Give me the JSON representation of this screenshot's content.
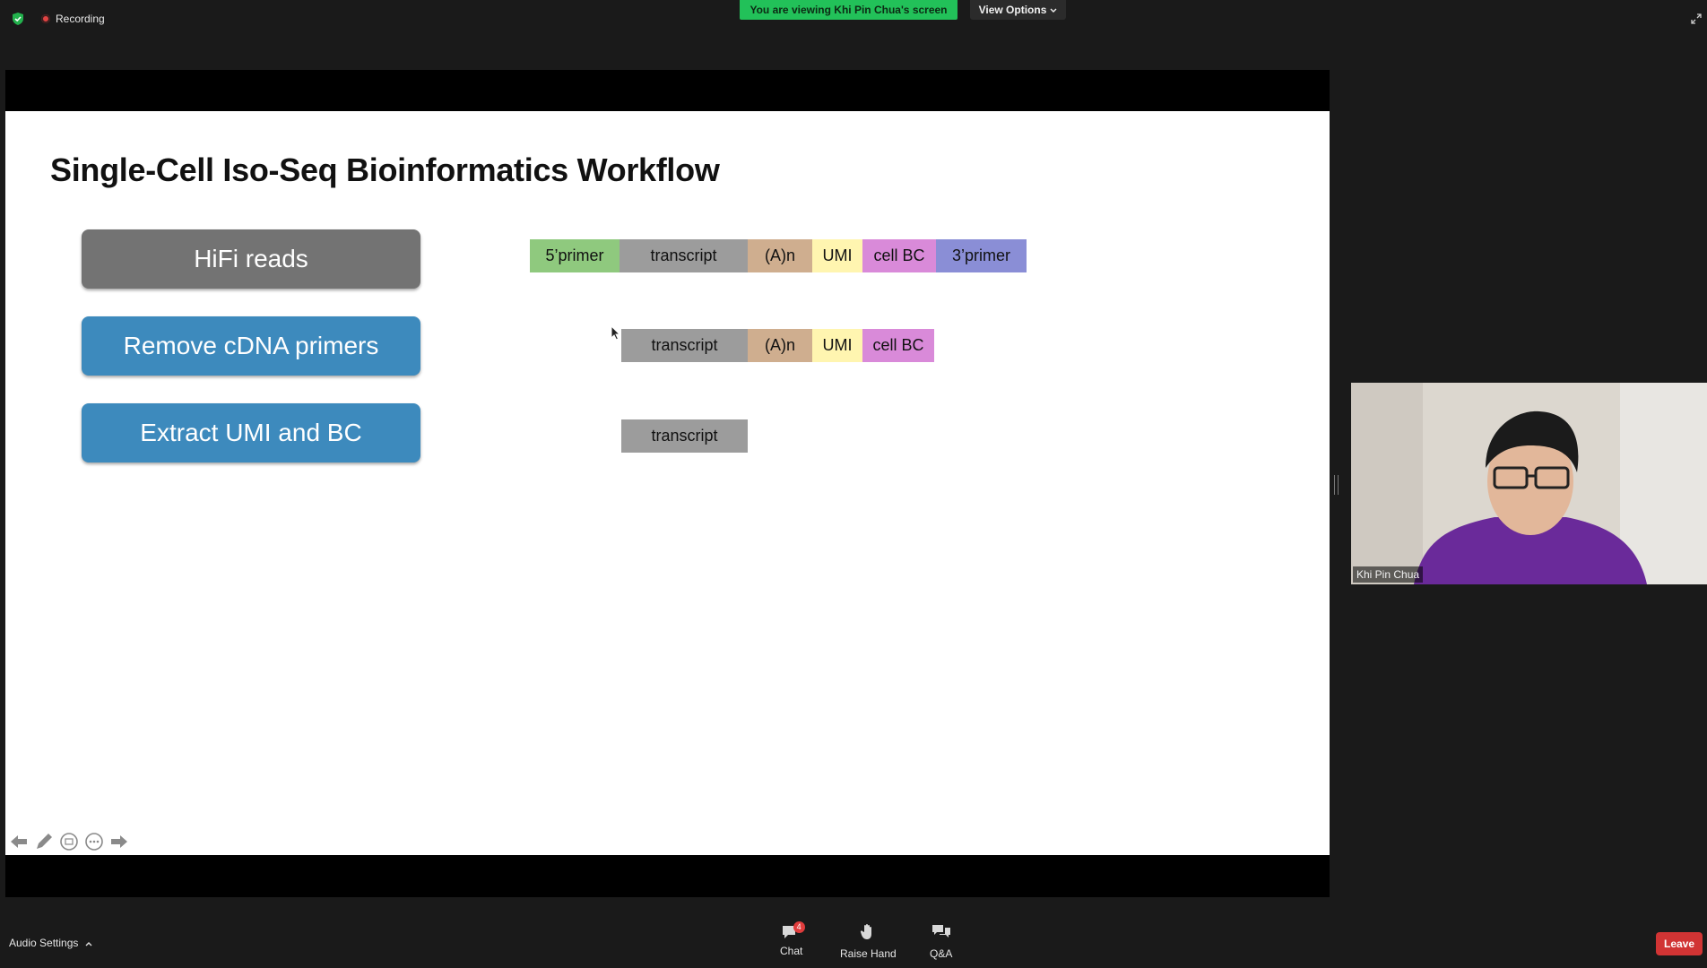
{
  "topbar": {
    "recording_label": "Recording",
    "viewing_label": "You are viewing Khi Pin Chua's screen",
    "view_options_label": "View Options"
  },
  "slide": {
    "title": "Single-Cell Iso-Seq Bioinformatics Workflow",
    "steps": [
      {
        "label": "HiFi reads",
        "color": "#737373"
      },
      {
        "label": "Remove cDNA primers",
        "color": "#3d8abd"
      },
      {
        "label": "Extract UMI and BC",
        "color": "#3d8abd"
      }
    ],
    "row1": {
      "five_primer": "5’primer",
      "transcript": "transcript",
      "polya": "(A)n",
      "umi": "UMI",
      "cell_bc": "cell BC",
      "three_primer": "3’primer"
    },
    "row2": {
      "transcript": "transcript",
      "polya": "(A)n",
      "umi": "UMI",
      "cell_bc": "cell BC"
    },
    "row3": {
      "transcript": "transcript"
    }
  },
  "video": {
    "participant_name": "Khi Pin Chua"
  },
  "bottombar": {
    "audio_settings_label": "Audio Settings",
    "chat_label": "Chat",
    "chat_badge": "4",
    "raise_hand_label": "Raise Hand",
    "qa_label": "Q&A",
    "leave_label": "Leave"
  },
  "colors": {
    "viewing_banner": "#22c159",
    "leave_button": "#d13434",
    "step_blue": "#3d8abd",
    "step_gray": "#737373"
  },
  "icons": [
    "shield-icon",
    "recording-icon",
    "chevron-down-icon",
    "expand-icon",
    "prev-slide-icon",
    "pen-icon",
    "slides-grid-icon",
    "more-icon",
    "next-slide-icon",
    "chat-icon",
    "raise-hand-icon",
    "qa-icon",
    "caret-up-icon"
  ]
}
